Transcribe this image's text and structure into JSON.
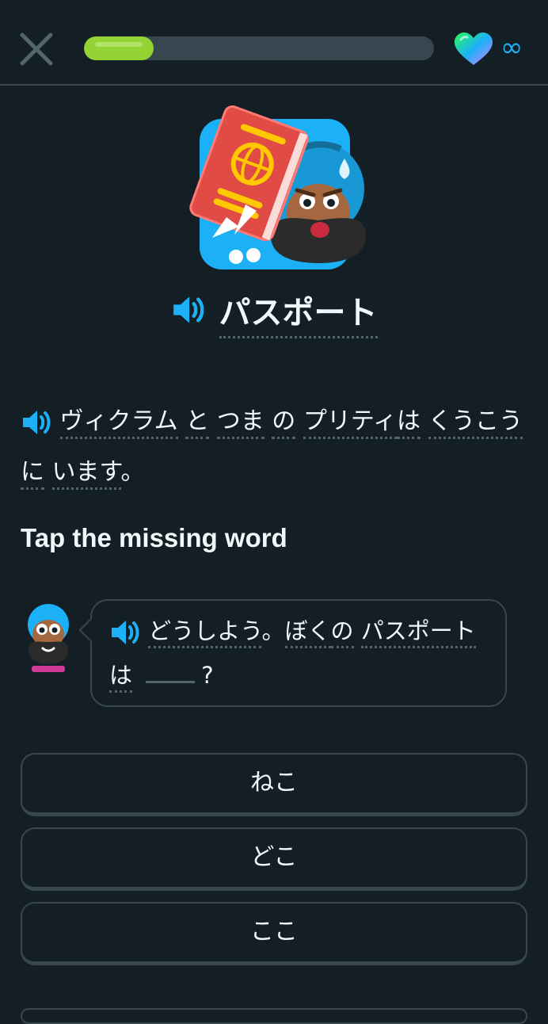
{
  "header": {
    "progress_fraction": 0.2,
    "hearts": "∞",
    "colors": {
      "progress": "#93d333",
      "track": "#37464f",
      "accent": "#1cb0f6"
    }
  },
  "lesson": {
    "title": "パスポート",
    "sentence_tokens": [
      "ヴィクラム",
      "と",
      "つま",
      "の",
      "プリティ",
      "は",
      "くうこう",
      "に",
      "います",
      "。"
    ],
    "instruction": "Tap the missing word",
    "dialog": {
      "line_part1_tokens": [
        "どうしよう",
        "。",
        "ぼく",
        "の",
        "パスポート",
        "は"
      ],
      "question_mark": "?"
    },
    "choices": [
      "ねこ",
      "どこ",
      "ここ"
    ]
  },
  "icons": [
    "close-icon",
    "heart-icon",
    "infinity-icon",
    "speaker-icon",
    "passport-illustration",
    "character-avatar"
  ]
}
